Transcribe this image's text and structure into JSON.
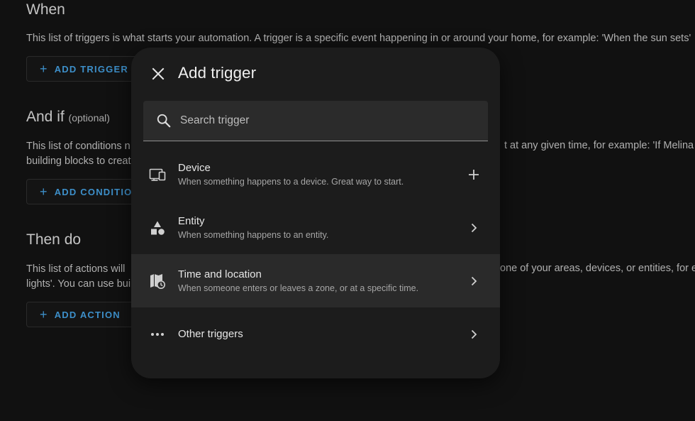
{
  "background": {
    "when": {
      "heading": "When",
      "description": "This list of triggers is what starts your automation. A trigger is a specific event happening in or around your home, for example: 'When the sun sets'",
      "button_label": "ADD TRIGGER"
    },
    "and_if": {
      "heading": "And if",
      "optional": "(optional)",
      "description_line1_left": "This list of conditions n",
      "description_line1_right": "t at any given time, for example: 'If Melina is",
      "description_line2_left": "building blocks to creat",
      "button_label": "ADD CONDITION"
    },
    "then_do": {
      "heading": "Then do",
      "description_line1_left": "This list of actions will",
      "description_line1_right": "one of your areas, devices, or entities, for ex",
      "description_line2_left": "lights'. You can use bui",
      "button_label": "ADD ACTION"
    }
  },
  "dialog": {
    "title": "Add trigger",
    "search": {
      "placeholder": "Search trigger",
      "value": ""
    },
    "items": [
      {
        "title": "Device",
        "description": "When something happens to a device. Great way to start.",
        "icon": "devices-icon",
        "action": "plus-icon"
      },
      {
        "title": "Entity",
        "description": "When something happens to an entity.",
        "icon": "shapes-icon",
        "action": "chevron-right-icon"
      },
      {
        "title": "Time and location",
        "description": "When someone enters or leaves a zone, or at a specific time.",
        "icon": "map-clock-icon",
        "action": "chevron-right-icon",
        "highlighted": true
      },
      {
        "title": "Other triggers",
        "description": "",
        "icon": "dots-horizontal-icon",
        "action": "chevron-right-icon"
      }
    ]
  },
  "colors": {
    "page_background": "#111111",
    "dialog_background": "#1c1c1c",
    "accent": "#3d8fc9",
    "highlight_row": "#2a2a2a"
  }
}
